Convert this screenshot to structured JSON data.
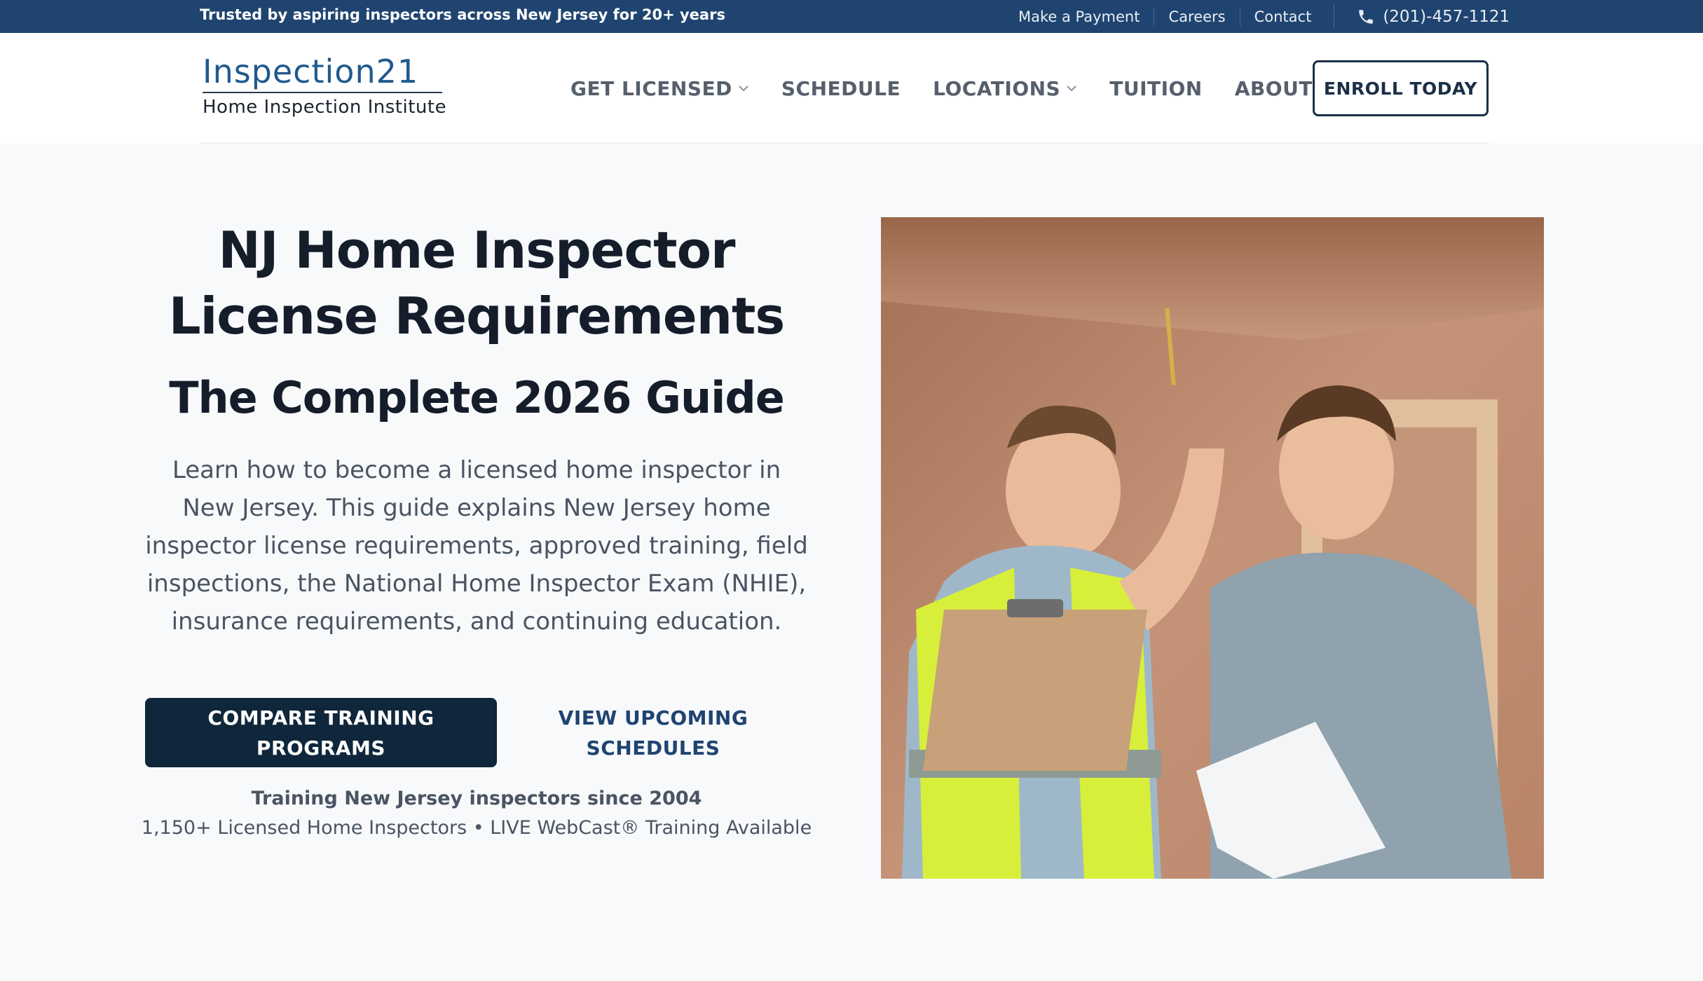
{
  "topbar": {
    "trust": "Trusted by aspiring inspectors across New Jersey for 20+ years",
    "links": [
      "Make a Payment",
      "Careers",
      "Contact"
    ],
    "phone": "(201)-457-1121",
    "phone_icon": "phone-icon"
  },
  "header": {
    "logo_mark": "Inspection21",
    "logo_sub": "Home Inspection Institute",
    "nav": [
      {
        "label": "GET LICENSED",
        "dropdown": true
      },
      {
        "label": "SCHEDULE",
        "dropdown": false
      },
      {
        "label": "LOCATIONS",
        "dropdown": true
      },
      {
        "label": "TUITION",
        "dropdown": false
      },
      {
        "label": "ABOUT",
        "dropdown": false
      }
    ],
    "enroll": "ENROLL TODAY"
  },
  "hero": {
    "title_line1": "NJ Home Inspector",
    "title_line2": "License Requirements",
    "subtitle": "The Complete 2026 Guide",
    "lead": "Learn how to become a licensed home inspector in New Jersey. This guide explains New Jersey home inspector license requirements, approved training, field inspections, the National Home Inspector Exam (NHIE), insurance requirements, and continuing education.",
    "primary_line1": "COMPARE TRAINING",
    "primary_line2": "PROGRAMS",
    "secondary_line1": "VIEW UPCOMING",
    "secondary_line2": "SCHEDULES",
    "since": "Training New Jersey inspectors since 2004",
    "stats": "1,150+ Licensed Home Inspectors • LIVE WebCast® Training Available"
  },
  "colors": {
    "topbar_bg": "#1f4470",
    "primary_button": "#0f263b",
    "link_blue": "#1f4470",
    "logo_blue": "#1f5a8e",
    "page_bg": "#f7f9fb"
  }
}
